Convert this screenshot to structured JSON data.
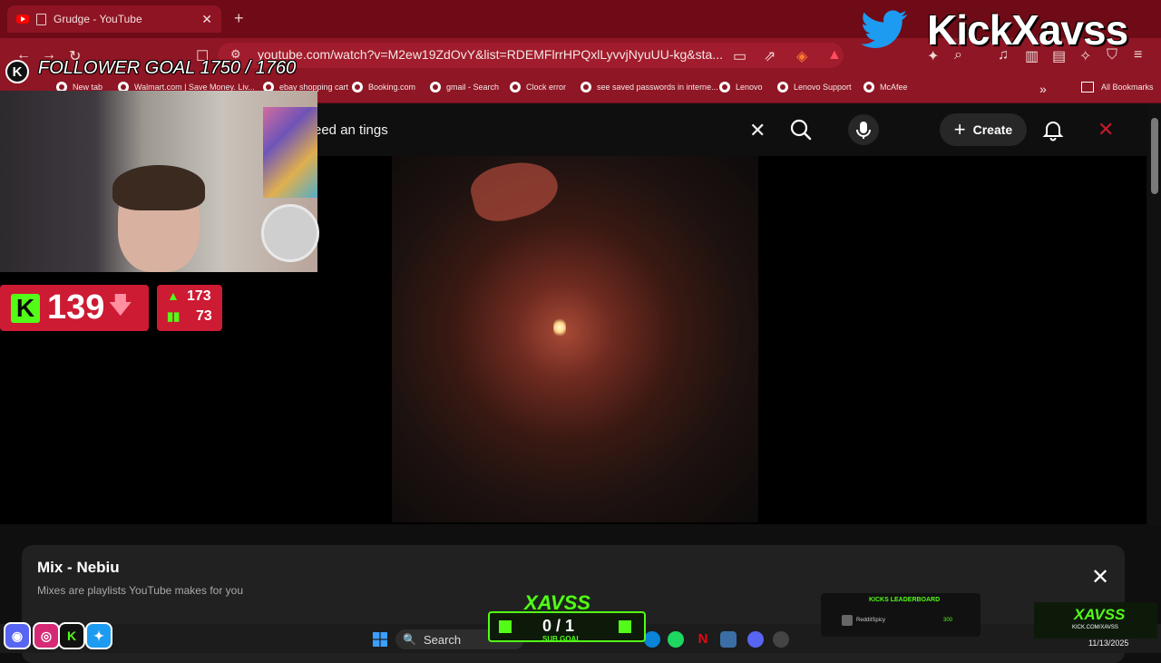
{
  "browser": {
    "tab_title": "Grudge - YouTube",
    "tab_close": "✕",
    "new_tab": "+",
    "url": "youtube.com/watch?v=M2ew19ZdOvY&list=RDEMFlrrHPQxlLyvvjNyuUU-kg&sta...",
    "bookmarks": [
      "New tab",
      "Walmart.com | Save Money. Liv...",
      "ebay shopping cart",
      "Booking.com",
      "gmail - Search",
      "Clock error",
      "see saved passwords in interne...",
      "Lenovo",
      "Lenovo Support",
      "McAfee"
    ],
    "all_bookmarks": "All Bookmarks",
    "more": "»"
  },
  "youtube": {
    "search_query": "eed an tings",
    "create_label": "Create",
    "clear_icon": "✕",
    "mix_title": "Mix - Nebiu",
    "mix_subtitle": "Mixes are playlists YouTube makes for you",
    "mix_close": "✕"
  },
  "overlay": {
    "follower_goal": "FOLLOWER GOAL 1750 / 1760",
    "kick_letter": "K",
    "kick_count": "139",
    "stat_up": "173",
    "stat_bars": "73",
    "brand": "KickXavss",
    "sub_goal_count": "0 / 1",
    "sub_goal_label": "SUB GOAL",
    "xavss_logo": "XAVSS",
    "leaderboard_title": "KICKS LEADERBOARD",
    "leaderboard_name": "RedditSpicy",
    "leaderboard_value": "300",
    "brand_name": "XAVSS",
    "brand_url": "KICK.COM/XAVSS"
  },
  "taskbar": {
    "search_label": "Search",
    "date": "11/13/2025"
  },
  "colors": {
    "chrome_red": "#8f1624",
    "kick_green": "#53fc18",
    "overlay_red": "#cc1b33"
  }
}
